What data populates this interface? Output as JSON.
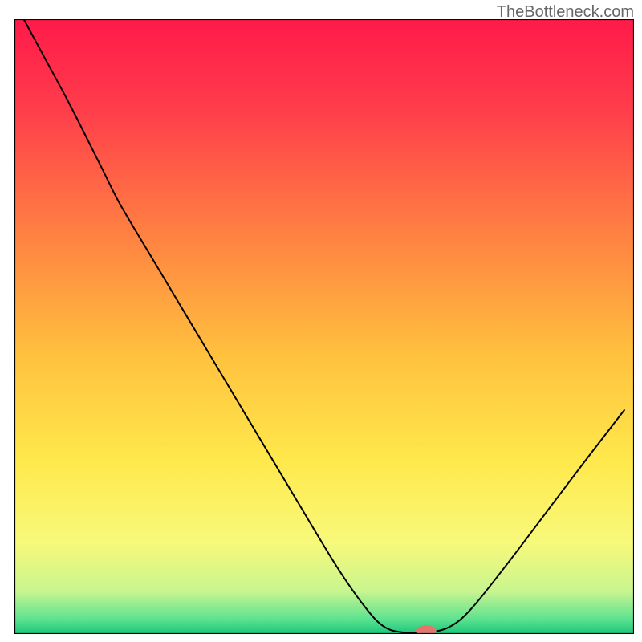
{
  "watermark": "TheBottleneck.com",
  "chart_data": {
    "type": "line",
    "title": "",
    "xlabel": "",
    "ylabel": "",
    "xlim": [
      0,
      100
    ],
    "ylim": [
      0,
      100
    ],
    "background_gradient": {
      "stops": [
        {
          "offset": 0.0,
          "color": "#ff1a4a"
        },
        {
          "offset": 0.15,
          "color": "#ff3e4b"
        },
        {
          "offset": 0.35,
          "color": "#ff8142"
        },
        {
          "offset": 0.55,
          "color": "#ffc23e"
        },
        {
          "offset": 0.72,
          "color": "#ffe94c"
        },
        {
          "offset": 0.85,
          "color": "#f8f97a"
        },
        {
          "offset": 0.93,
          "color": "#c9f58f"
        },
        {
          "offset": 0.975,
          "color": "#5fe390"
        },
        {
          "offset": 1.0,
          "color": "#19c57a"
        }
      ]
    },
    "series": [
      {
        "name": "bottleneck-curve",
        "color": "#000000",
        "width": 2,
        "points": [
          {
            "x": 1.5,
            "y": 100.0
          },
          {
            "x": 5.0,
            "y": 93.5
          },
          {
            "x": 9.0,
            "y": 86.0
          },
          {
            "x": 14.0,
            "y": 76.0
          },
          {
            "x": 17.0,
            "y": 70.0
          },
          {
            "x": 22.0,
            "y": 61.5
          },
          {
            "x": 30.0,
            "y": 48.0
          },
          {
            "x": 38.0,
            "y": 34.5
          },
          {
            "x": 46.0,
            "y": 21.0
          },
          {
            "x": 52.0,
            "y": 11.0
          },
          {
            "x": 56.5,
            "y": 4.5
          },
          {
            "x": 59.5,
            "y": 1.3
          },
          {
            "x": 62.5,
            "y": 0.3
          },
          {
            "x": 67.0,
            "y": 0.3
          },
          {
            "x": 70.5,
            "y": 1.3
          },
          {
            "x": 74.0,
            "y": 4.4
          },
          {
            "x": 80.0,
            "y": 12.0
          },
          {
            "x": 86.0,
            "y": 20.0
          },
          {
            "x": 92.0,
            "y": 28.0
          },
          {
            "x": 98.5,
            "y": 36.5
          }
        ]
      }
    ],
    "marker": {
      "name": "optimal-point",
      "color": "#e2766e",
      "x": 66.5,
      "y": 0.5,
      "rx": 1.6,
      "ry": 0.9
    }
  }
}
